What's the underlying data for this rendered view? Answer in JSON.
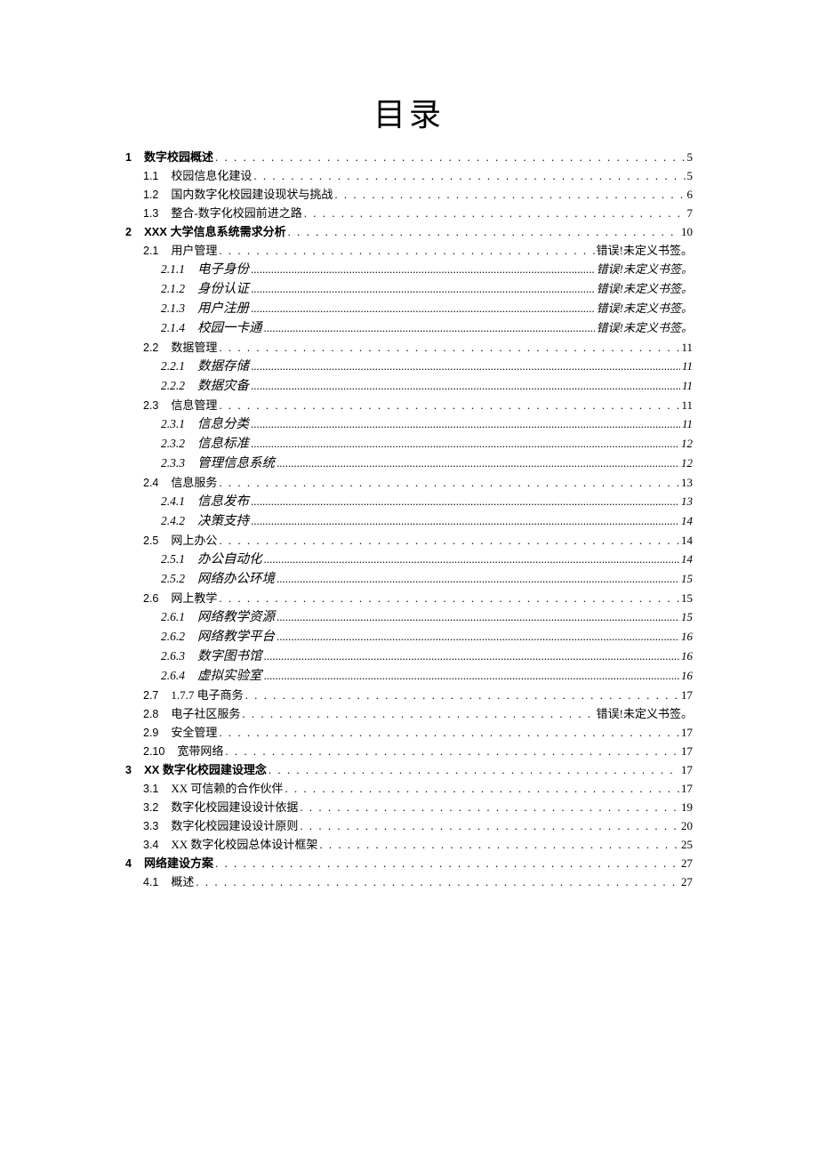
{
  "title": "目录",
  "error_bookmark": "错误!未定义书签。",
  "toc": [
    {
      "level": 1,
      "num": "1",
      "label": "数字校园概述",
      "page": "5",
      "leader": "dots"
    },
    {
      "level": 2,
      "num": "1.1",
      "label": "校园信息化建设",
      "page": "5",
      "leader": "dots"
    },
    {
      "level": 2,
      "num": "1.2",
      "label": "国内数字化校园建设现状与挑战",
      "page": "6",
      "leader": "dots"
    },
    {
      "level": 2,
      "num": "1.3",
      "label": "整合-数字化校园前进之路",
      "page": "7",
      "leader": "dots"
    },
    {
      "level": 1,
      "num": "2",
      "label": "XXX 大学信息系统需求分析",
      "page": "10",
      "leader": "dots"
    },
    {
      "level": 2,
      "num": "2.1",
      "label": "用户管理",
      "page": "错误!未定义书签。",
      "leader": "dots",
      "err": true
    },
    {
      "level": 3,
      "num": "2.1.1",
      "label": "电子身份",
      "page": "错误!未定义书签。",
      "leader": "ddots",
      "err": true
    },
    {
      "level": 3,
      "num": "2.1.2",
      "label": "身份认证",
      "page": "错误!未定义书签。",
      "leader": "ddots",
      "err": true
    },
    {
      "level": 3,
      "num": "2.1.3",
      "label": "用户注册",
      "page": "错误!未定义书签。",
      "leader": "ddots",
      "err": true
    },
    {
      "level": 3,
      "num": "2.1.4",
      "label": "校园一卡通",
      "page": "错误!未定义书签。",
      "leader": "ddots",
      "err": true
    },
    {
      "level": 2,
      "num": "2.2",
      "label": "数据管理",
      "page": "11",
      "leader": "dots"
    },
    {
      "level": 3,
      "num": "2.2.1",
      "label": "数据存储",
      "page": "11",
      "leader": "ddots"
    },
    {
      "level": 3,
      "num": "2.2.2",
      "label": "数据灾备",
      "page": "11",
      "leader": "ddots"
    },
    {
      "level": 2,
      "num": "2.3",
      "label": "信息管理",
      "page": "11",
      "leader": "dots"
    },
    {
      "level": 3,
      "num": "2.3.1",
      "label": "信息分类",
      "page": "11",
      "leader": "ddots"
    },
    {
      "level": 3,
      "num": "2.3.2",
      "label": "信息标准",
      "page": "12",
      "leader": "ddots"
    },
    {
      "level": 3,
      "num": "2.3.3",
      "label": "管理信息系统",
      "page": "12",
      "leader": "ddots"
    },
    {
      "level": 2,
      "num": "2.4",
      "label": "信息服务",
      "page": "13",
      "leader": "dots"
    },
    {
      "level": 3,
      "num": "2.4.1",
      "label": "信息发布",
      "page": "13",
      "leader": "ddots"
    },
    {
      "level": 3,
      "num": "2.4.2",
      "label": "决策支持",
      "page": "14",
      "leader": "ddots"
    },
    {
      "level": 2,
      "num": "2.5",
      "label": "网上办公",
      "page": "14",
      "leader": "dots"
    },
    {
      "level": 3,
      "num": "2.5.1",
      "label": "办公自动化",
      "page": "14",
      "leader": "ddots"
    },
    {
      "level": 3,
      "num": "2.5.2",
      "label": "网络办公环境",
      "page": "15",
      "leader": "ddots"
    },
    {
      "level": 2,
      "num": "2.6",
      "label": "网上教学",
      "page": "15",
      "leader": "dots"
    },
    {
      "level": 3,
      "num": "2.6.1",
      "label": "网络教学资源",
      "page": "15",
      "leader": "ddots"
    },
    {
      "level": 3,
      "num": "2.6.2",
      "label": "网络教学平台",
      "page": "16",
      "leader": "ddots"
    },
    {
      "level": 3,
      "num": "2.6.3",
      "label": "数字图书馆",
      "page": "16",
      "leader": "ddots"
    },
    {
      "level": 3,
      "num": "2.6.4",
      "label": "虚拟实验室",
      "page": "16",
      "leader": "ddots"
    },
    {
      "level": 2,
      "num": "2.7",
      "label": "1.7.7 电子商务",
      "page": "17",
      "leader": "dots"
    },
    {
      "level": 2,
      "num": "2.8",
      "label": "电子社区服务",
      "page": "错误!未定义书签。",
      "leader": "dots",
      "err": true
    },
    {
      "level": 2,
      "num": "2.9",
      "label": "安全管理",
      "page": "17",
      "leader": "dots"
    },
    {
      "level": 2,
      "num": "2.10",
      "label": "宽带网络",
      "page": "17",
      "leader": "dots"
    },
    {
      "level": 1,
      "num": "3",
      "label": "XX 数字化校园建设理念",
      "page": "17",
      "leader": "dots"
    },
    {
      "level": 2,
      "num": "3.1",
      "label": "XX 可信赖的合作伙伴",
      "page": "17",
      "leader": "dots"
    },
    {
      "level": 2,
      "num": "3.2",
      "label": "数字化校园建设设计依据",
      "page": "19",
      "leader": "dots"
    },
    {
      "level": 2,
      "num": "3.3",
      "label": "数字化校园建设设计原则",
      "page": "20",
      "leader": "dots"
    },
    {
      "level": 2,
      "num": "3.4",
      "label": "XX 数字化校园总体设计框架",
      "page": "25",
      "leader": "dots"
    },
    {
      "level": 1,
      "num": "4",
      "label": "网络建设方案",
      "page": "27",
      "leader": "dots"
    },
    {
      "level": 2,
      "num": "4.1",
      "label": "概述",
      "page": "27",
      "leader": "dots"
    }
  ]
}
